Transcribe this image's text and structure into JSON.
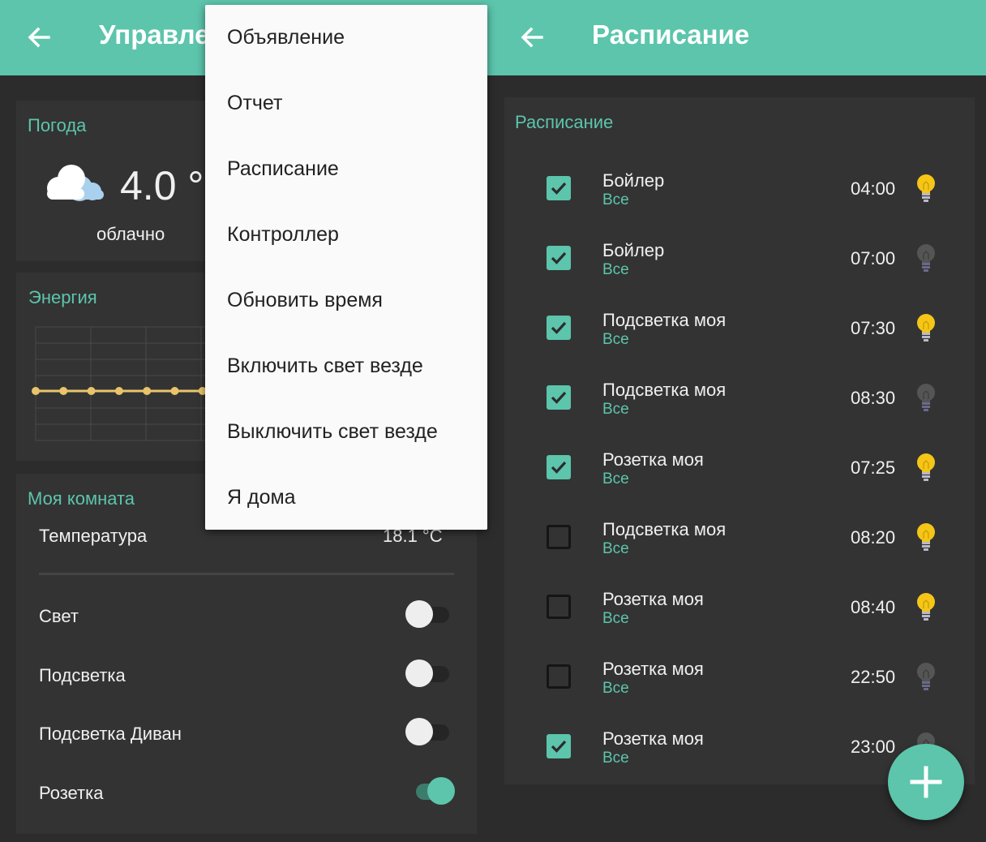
{
  "left": {
    "title": "Управление",
    "weather": {
      "title": "Погода",
      "temperature": "4.0 °",
      "condition": "облачно"
    },
    "energy": {
      "title": "Энергия",
      "line_color": "#e9c46a"
    },
    "room": {
      "title": "Моя комната",
      "temperature_label": "Температура",
      "temperature_value": "18.1 °C",
      "switches": [
        {
          "label": "Свет",
          "on": false
        },
        {
          "label": "Подсветка",
          "on": false
        },
        {
          "label": "Подсветка Диван",
          "on": false
        },
        {
          "label": "Розетка",
          "on": true
        }
      ]
    }
  },
  "menu": {
    "items": [
      "Объявление",
      "Отчет",
      "Расписание",
      "Контроллер",
      "Обновить время",
      "Включить свет везде",
      "Выключить свет везде",
      "Я дома"
    ]
  },
  "right": {
    "title": "Расписание",
    "card_title": "Расписание",
    "rows": [
      {
        "name": "Бойлер",
        "days": "Все",
        "time": "04:00",
        "checked": true,
        "bulb_on": true
      },
      {
        "name": "Бойлер",
        "days": "Все",
        "time": "07:00",
        "checked": true,
        "bulb_on": false
      },
      {
        "name": "Подсветка моя",
        "days": "Все",
        "time": "07:30",
        "checked": true,
        "bulb_on": true
      },
      {
        "name": "Подсветка моя",
        "days": "Все",
        "time": "08:30",
        "checked": true,
        "bulb_on": false
      },
      {
        "name": "Розетка моя",
        "days": "Все",
        "time": "07:25",
        "checked": true,
        "bulb_on": true
      },
      {
        "name": "Подсветка моя",
        "days": "Все",
        "time": "08:20",
        "checked": false,
        "bulb_on": true
      },
      {
        "name": "Розетка моя",
        "days": "Все",
        "time": "08:40",
        "checked": false,
        "bulb_on": true
      },
      {
        "name": "Розетка моя",
        "days": "Все",
        "time": "22:50",
        "checked": false,
        "bulb_on": false
      },
      {
        "name": "Розетка моя",
        "days": "Все",
        "time": "23:00",
        "checked": true,
        "bulb_on": false
      }
    ]
  },
  "colors": {
    "accent": "#5cc5ac",
    "background": "#2c2c2c",
    "card": "#333333",
    "bulb_on": "#f5c518",
    "bulb_off": "#555555"
  },
  "icons": {
    "back": "arrow-left-icon",
    "weather": "cloud-icon",
    "fab": "plus-icon",
    "bulb": "lightbulb-icon"
  }
}
